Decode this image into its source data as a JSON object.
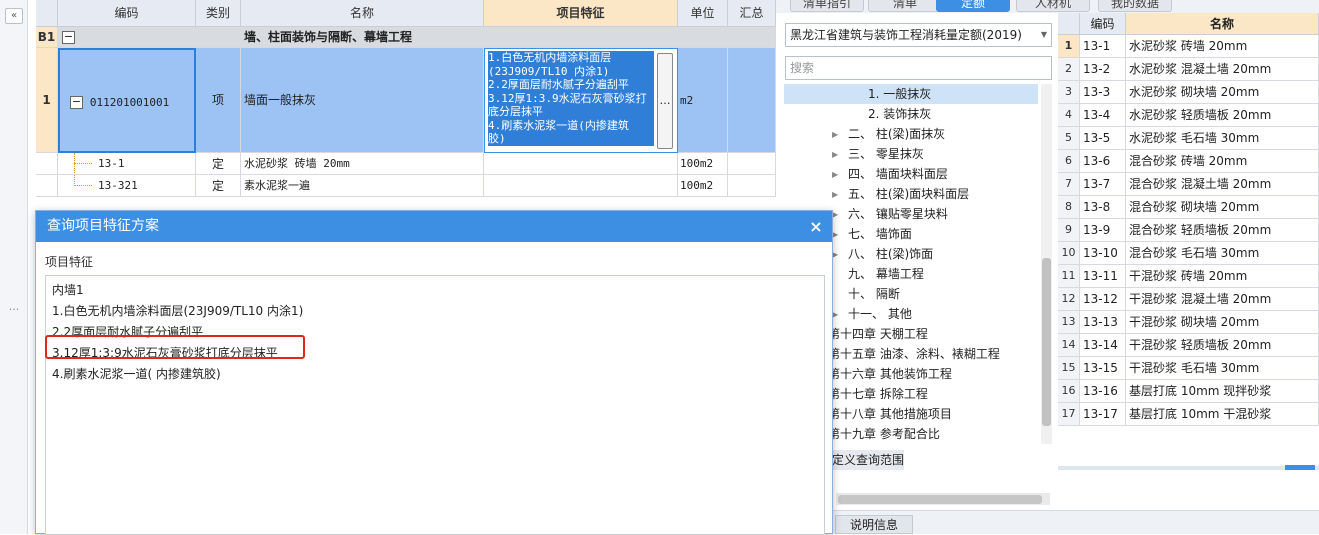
{
  "grid": {
    "headers": [
      "",
      "编码",
      "类别",
      "名称",
      "项目特征",
      "单位",
      "汇总"
    ],
    "group_row": {
      "num": "B1",
      "toggle": "−",
      "title": "墙、柱面装饰与隔断、幕墙工程"
    },
    "main_row": {
      "num": "1",
      "toggle": "−",
      "code": "011201001001",
      "type": "项",
      "name": "墙面一般抹灰",
      "feature_lines": [
        "1.白色无机内墙涂料面层",
        "(23J909/TL10 内涂1)",
        "2.2厚面层耐水腻子分遍刮平",
        "3.12厚1:3.9水泥石灰膏砂浆打",
        "底分层抹平",
        "4.刷素水泥浆一道(内掺建筑",
        "胶)"
      ],
      "more_button": "…",
      "unit": "m2"
    },
    "sub_rows": [
      {
        "code": "13-1",
        "type": "定",
        "name": "水泥砂浆 砖墙 20mm",
        "unit": "100m2"
      },
      {
        "code": "13-321",
        "type": "定",
        "name": "素水泥浆一遍",
        "unit": "100m2"
      }
    ]
  },
  "dialog": {
    "title": "查询项目特征方案",
    "close": "×",
    "label": "项目特征",
    "lines": [
      "内墙1",
      "1.白色无机内墙涂料面层(23J909/TL10 内涂1)",
      "2.2厚面层耐水腻子分遍刮平",
      "3.12厚1:3:9水泥石灰膏砂浆打底分层抹平",
      "4.刷素水泥浆一道( 内掺建筑胶)"
    ]
  },
  "right_panel": {
    "tabs": [
      "清单指引",
      "清单",
      "定额",
      "人材机",
      "我的数据"
    ],
    "active_tab": "定额",
    "quota_select": "黑龙江省建筑与装饰工程消耗量定额(2019)",
    "search_placeholder": "搜索",
    "tree": [
      {
        "label": "1. 一般抹灰",
        "selected": true
      },
      {
        "label": "2. 装饰抹灰"
      },
      {
        "label": "二、 柱(梁)面抹灰",
        "arrow": true
      },
      {
        "label": "三、 零星抹灰",
        "arrow": true
      },
      {
        "label": "四、 墙面块料面层",
        "arrow": true
      },
      {
        "label": "五、 柱(梁)面块料面层",
        "arrow": true
      },
      {
        "label": "六、 镶贴零星块料",
        "arrow": true
      },
      {
        "label": "七、 墙饰面",
        "arrow": true
      },
      {
        "label": "八、 柱(梁)饰面",
        "arrow": true
      },
      {
        "label": "九、 幕墙工程"
      },
      {
        "label": "十、 隔断"
      },
      {
        "label": "十一、 其他",
        "arrow": true
      },
      {
        "label": "第十四章 天棚工程"
      },
      {
        "label": "第十五章 油漆、涂料、裱糊工程"
      },
      {
        "label": "第十六章 其他装饰工程"
      },
      {
        "label": "第十七章 拆除工程"
      },
      {
        "label": "第十八章 其他措施项目"
      },
      {
        "label": "第十九章 参考配合比"
      }
    ],
    "scope_label": "定义查询范围",
    "bottom_tab": "说明信息",
    "table": {
      "headers": [
        "",
        "编码",
        "名称"
      ],
      "rows": [
        {
          "num": "1",
          "code": "13-1",
          "name": "水泥砂浆 砖墙 20mm"
        },
        {
          "num": "2",
          "code": "13-2",
          "name": "水泥砂浆 混凝土墙 20mm"
        },
        {
          "num": "3",
          "code": "13-3",
          "name": "水泥砂浆 砌块墙 20mm"
        },
        {
          "num": "4",
          "code": "13-4",
          "name": "水泥砂浆 轻质墙板 20mm"
        },
        {
          "num": "5",
          "code": "13-5",
          "name": "水泥砂浆 毛石墙 30mm"
        },
        {
          "num": "6",
          "code": "13-6",
          "name": "混合砂浆 砖墙 20mm"
        },
        {
          "num": "7",
          "code": "13-7",
          "name": "混合砂浆 混凝土墙 20mm"
        },
        {
          "num": "8",
          "code": "13-8",
          "name": "混合砂浆 砌块墙 20mm"
        },
        {
          "num": "9",
          "code": "13-9",
          "name": "混合砂浆 轻质墙板 20mm"
        },
        {
          "num": "10",
          "code": "13-10",
          "name": "混合砂浆 毛石墙 30mm"
        },
        {
          "num": "11",
          "code": "13-11",
          "name": "干混砂浆 砖墙 20mm"
        },
        {
          "num": "12",
          "code": "13-12",
          "name": "干混砂浆 混凝土墙 20mm"
        },
        {
          "num": "13",
          "code": "13-13",
          "name": "干混砂浆 砌块墙 20mm"
        },
        {
          "num": "14",
          "code": "13-14",
          "name": "干混砂浆 轻质墙板 20mm"
        },
        {
          "num": "15",
          "code": "13-15",
          "name": "干混砂浆 毛石墙 30mm"
        },
        {
          "num": "16",
          "code": "13-16",
          "name": "基层打底 10mm 现拌砂浆"
        },
        {
          "num": "17",
          "code": "13-17",
          "name": "基层打底 10mm 干混砂浆"
        }
      ]
    }
  },
  "left_strip": {
    "collapse": "«",
    "dots": "..."
  },
  "colors": {
    "accent": "#3d8fe3",
    "header_highlight": "#fbe7c6",
    "selection": "#9cc3f4",
    "warning_box": "#e0271b"
  }
}
